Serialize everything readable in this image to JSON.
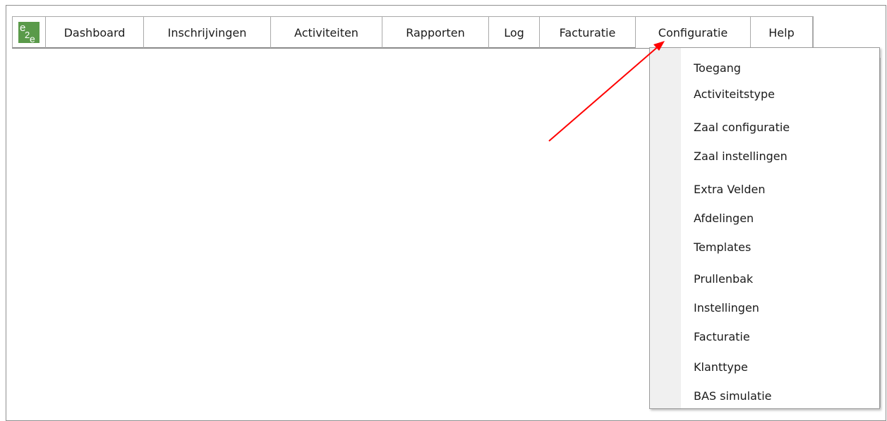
{
  "app": {
    "logo_icon": "e2e-logo-icon",
    "accent": "#5a9a4a"
  },
  "menubar": {
    "items": [
      {
        "label": "Dashboard"
      },
      {
        "label": "Inschrijvingen"
      },
      {
        "label": "Activiteiten"
      },
      {
        "label": "Rapporten"
      },
      {
        "label": "Log"
      },
      {
        "label": "Facturatie"
      },
      {
        "label": "Configuratie"
      },
      {
        "label": "Help"
      }
    ],
    "open_menu": "Configuratie"
  },
  "dropdown": {
    "items": [
      {
        "label": "Toegang"
      },
      {
        "label": "Activiteitstype"
      },
      {
        "label": "Zaal configuratie"
      },
      {
        "label": "Zaal instellingen"
      },
      {
        "label": "Extra Velden"
      },
      {
        "label": "Afdelingen"
      },
      {
        "label": "Templates"
      },
      {
        "label": "Prullenbak"
      },
      {
        "label": "Instellingen"
      },
      {
        "label": "Facturatie"
      },
      {
        "label": "Klanttype"
      },
      {
        "label": "BAS simulatie"
      }
    ]
  },
  "annotation": {
    "color": "#ff0000",
    "icon": "red-arrow-annotation"
  }
}
